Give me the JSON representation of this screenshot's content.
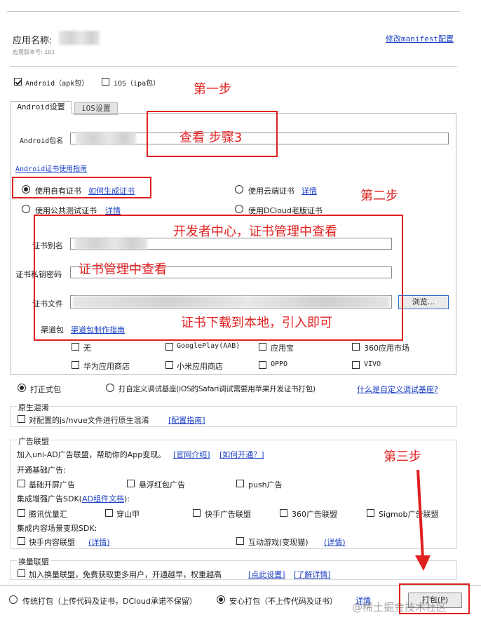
{
  "app": {
    "name_label": "应用名称:",
    "version_label": "应用版本号: 101",
    "modify_manifest_link": "修改manifest配置"
  },
  "platforms": {
    "android_label": "Android（apk包）",
    "android_checked": true,
    "ios_label": "iOS（ipa包）",
    "ios_checked": false
  },
  "tabs": [
    {
      "label": "Android设置",
      "active": true
    },
    {
      "label": "iOS设置",
      "active": false
    }
  ],
  "android": {
    "package_label": "Android包名",
    "cert_guide_link": "Android证书使用指南",
    "cert_options": {
      "own": "使用自有证书",
      "own_link": "如何生成证书",
      "cloud": "使用云端证书",
      "cloud_link": "详情",
      "public": "使用公共测试证书",
      "public_link": "详情",
      "dcloud_old": "使用DCloud老版证书"
    },
    "alias_label": "证书别名",
    "password_label": "证书私钥密码",
    "file_label": "证书文件",
    "browse_button": "浏览...",
    "channel_label": "渠道包",
    "channel_link": "渠道包制作指南",
    "channels": [
      "无",
      "GooglePlay(AAB)",
      "应用宝",
      "360应用市场",
      "华为应用商店",
      "小米应用商店",
      "OPPO",
      "VIVO"
    ]
  },
  "build_type": {
    "formal": "打正式包",
    "custom": "打自定义调试基座(iOS的Safari调试需要用苹果开发证书打包)",
    "custom_link": "什么是自定义调试基座?"
  },
  "obfuscation": {
    "title": "原生混淆",
    "option": "对配置的js/nvue文件进行原生混淆",
    "link": "[配置指南]"
  },
  "ads": {
    "title": "广告联盟",
    "desc": "加入uni-AD广告联盟，帮助你的App变现。",
    "link_intro": "[官网介绍]",
    "link_open": "[如何开通？]",
    "basic_title": "开通基础广告:",
    "basic": [
      "基础开屏广告",
      "悬浮红包广告",
      "push广告"
    ],
    "sdk_title_prefix": "集成增强广告SDK(",
    "sdk_title_link": "AD组件文档",
    "sdk_title_suffix": "):",
    "sdk": [
      "腾讯优量汇",
      "穿山甲",
      "快手广告联盟",
      "360广告联盟",
      "Sigmob广告联盟"
    ],
    "content_title": "集成内容场景变现SDK:",
    "content": [
      "快手内容联盟",
      "互动游戏(变现猫)"
    ],
    "content_link": "(详情)"
  },
  "exchange": {
    "title": "换量联盟",
    "option": "加入换量联盟，免费获取更多用户，开通越早，权重越高",
    "link_settings": "[点此设置]",
    "link_details": "[了解详情]"
  },
  "bottom": {
    "traditional": "传统打包（上传代码及证书，DCloud承诺不保留）",
    "safe": "安心打包（不上传代码及证书）",
    "detail_link": "详情",
    "pack_button": "打包(P)",
    "watermark": "@稀土掘金技术社区"
  },
  "annotations": {
    "step1": "第一步",
    "view_step3": "查看 步骤3",
    "step2": "第二步",
    "dev_center": "开发者中心，证书管理中查看",
    "cert_manage": "证书管理中查看",
    "download_cert": "证书下载到本地，引入即可",
    "step3": "第三步",
    "red_color": "#e02020"
  }
}
